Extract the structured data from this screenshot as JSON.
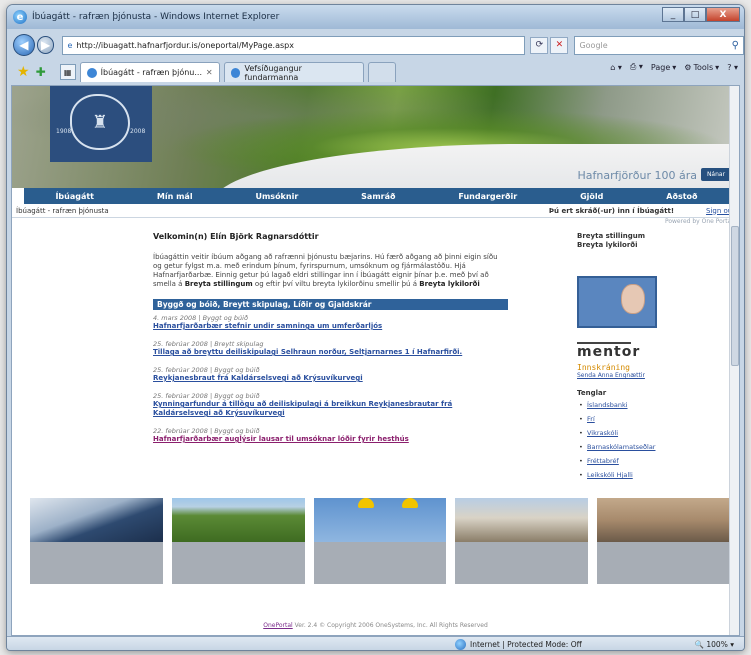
{
  "window": {
    "title": "Íbúagátt - rafræn þjónusta - Windows Internet Explorer",
    "minimize": "_",
    "maximize": "□",
    "close": "X"
  },
  "address": {
    "url": "http://ibuagatt.hafnarfjordur.is/oneportal/MyPage.aspx",
    "search_placeholder": "Google"
  },
  "tabs": [
    {
      "label": "Íbúagátt - rafræn þjónu..."
    },
    {
      "label": "Vefsíðugangur fundarmanna"
    }
  ],
  "commands": {
    "page": "Page",
    "tools": "Tools"
  },
  "banner": {
    "tagline": "Hafnarfjörður 100 ára",
    "tag_button": "Nánar",
    "logo_year_left": "1908",
    "logo_year_right": "2008"
  },
  "nav": [
    "Íbúagátt",
    "Mín mál",
    "Umsóknir",
    "Samráð",
    "Fundargerðir",
    "Gjöld",
    "Aðstoð"
  ],
  "statusline": {
    "left": "Íbúagátt - rafræn þjónusta",
    "right": "Þú ert skráð(-ur) inn í Íbúagátt!",
    "signout": "Sign out"
  },
  "powered": "Powered by One Portal",
  "main": {
    "welcome": "Velkomin(n) Elín Björk Ragnarsdóttir",
    "intro": "Íbúagáttin veitir íbúum aðgang að rafrænni þjónustu bæjarins. Hú færð aðgang að þinni eigin síðu og getur fylgst m.a. með erindum þínum, fyrirspurnum, umsóknum og fjármálastöðu. Hjá Hafnarfjarðarbæ. Einnig getur þú lagað eldri stillingar inn í Íbúagátt eignir þínar þ.e. með því að smella á ",
    "intro_link1": "Breyta stillingum",
    "intro_mid": " og eftir því viltu breyta lykilorðinu smellir þú á ",
    "intro_link2": "Breyta lykilorði",
    "news_header": "Byggð og bóið, Breytt skipulag, Líðir og Gjaldskrár",
    "news": [
      {
        "date": "4. mars 2008 | Byggt og búið",
        "title": "Hafnarfjarðarbær stefnir undir samninga um umferðarljós"
      },
      {
        "date": "25. febrúar 2008 | Breytt skipulag",
        "title": "Tillaga að breyttu deiliskipulagi Selhraun norður, Seltjarnarnes 1 í Hafnarfirði."
      },
      {
        "date": "25. febrúar 2008 | Byggt og búið",
        "title": "Reykjanesbraut frá Kaldárselsvegi að Krýsuvíkurvegi"
      },
      {
        "date": "25. febrúar 2008 | Byggt og búið",
        "title": "Kynningarfundur á tillögu að deiliskipulagi á breikkun Reykjanesbrautar frá Kaldárselsvegi að Krýsuvíkurvegi"
      },
      {
        "date": "22. febrúar 2008 | Byggt og búið",
        "title": "Hafnarfjarðarbær auglýsir lausar til umsóknar lóðir fyrir hesthús"
      }
    ]
  },
  "sidebar": {
    "link1": "Breyta stillingum",
    "link2": "Breyta lykilorði",
    "mentor": "mentor",
    "login": "Innskráning",
    "login_sub": "Senda Anna Engnættir",
    "tools_title": "Tenglar",
    "tools": [
      "Íslandsbanki",
      "Frí",
      "Vikraskóli",
      "Barnaskólamatseðlar",
      "Fréttabréf",
      "Leikskóli Hjalli"
    ]
  },
  "footer": {
    "link": "OnePortal",
    "text": " Ver. 2.4 © Copyright 2006 OneSystems, Inc. All Rights Reserved"
  },
  "statusbar": {
    "zone": "Internet | Protected Mode: Off",
    "zoom": "100%"
  }
}
